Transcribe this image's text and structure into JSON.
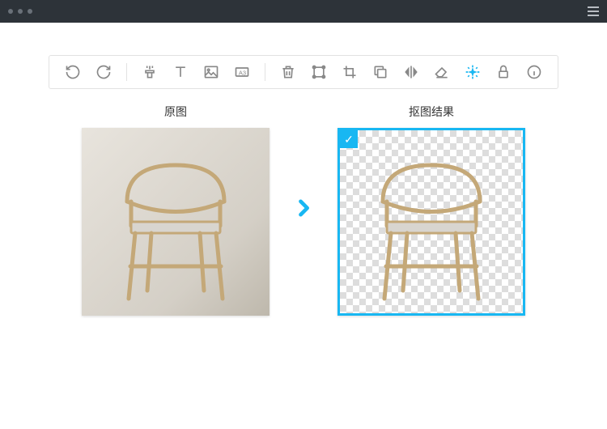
{
  "labels": {
    "original": "原图",
    "result": "抠图结果"
  },
  "colors": {
    "accent": "#18b7f2",
    "titlebar": "#2d3339"
  },
  "toolbar": {
    "activeTool": "magic-wand"
  }
}
